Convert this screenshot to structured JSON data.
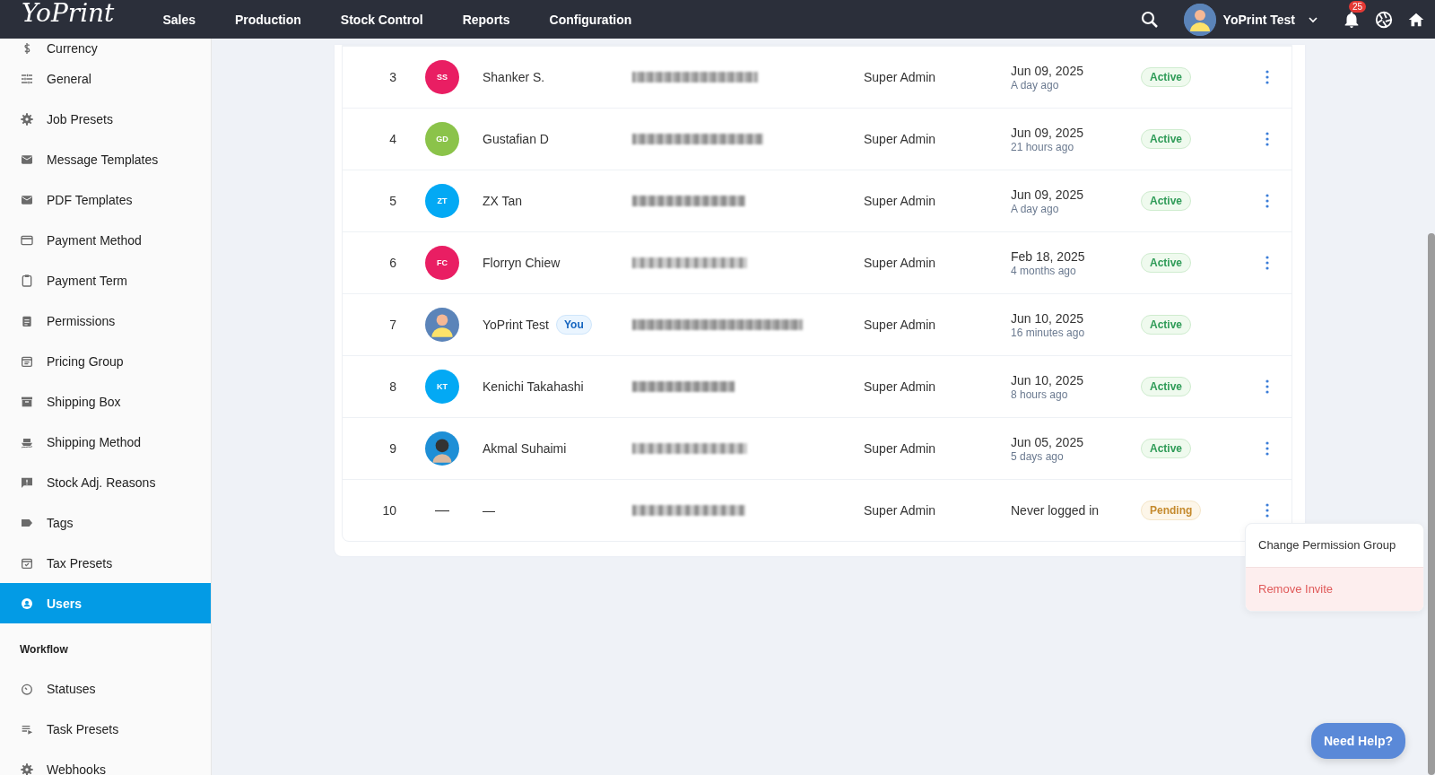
{
  "header": {
    "logo": "YoPrint",
    "nav": [
      {
        "label": "Sales"
      },
      {
        "label": "Production"
      },
      {
        "label": "Stock Control"
      },
      {
        "label": "Reports"
      },
      {
        "label": "Configuration"
      }
    ],
    "user_name": "YoPrint Test",
    "notification_count": "25"
  },
  "sidebar": {
    "items": [
      {
        "label": "Currency",
        "selected": false
      },
      {
        "label": "General",
        "selected": false
      },
      {
        "label": "Job Presets",
        "selected": false
      },
      {
        "label": "Message Templates",
        "selected": false
      },
      {
        "label": "PDF Templates",
        "selected": false
      },
      {
        "label": "Payment Method",
        "selected": false
      },
      {
        "label": "Payment Term",
        "selected": false
      },
      {
        "label": "Permissions",
        "selected": false
      },
      {
        "label": "Pricing Group",
        "selected": false
      },
      {
        "label": "Shipping Box",
        "selected": false
      },
      {
        "label": "Shipping Method",
        "selected": false
      },
      {
        "label": "Stock Adj. Reasons",
        "selected": false
      },
      {
        "label": "Tags",
        "selected": false
      },
      {
        "label": "Tax Presets",
        "selected": false
      },
      {
        "label": "Users",
        "selected": true
      }
    ],
    "section_title": "Workflow",
    "section_items": [
      {
        "label": "Statuses",
        "selected": false
      },
      {
        "label": "Task Presets",
        "selected": false
      },
      {
        "label": "Webhooks",
        "selected": false
      }
    ]
  },
  "users": {
    "rows": [
      {
        "number": "3",
        "avatar": {
          "kind": "initials",
          "text": "SS",
          "color": "#e91e63"
        },
        "name": "Shanker S.",
        "you": false,
        "role": "Super Admin",
        "date": "Jun 09, 2025",
        "ago": "A day ago",
        "status": {
          "kind": "active",
          "label": "Active"
        },
        "menu": true
      },
      {
        "number": "4",
        "avatar": {
          "kind": "initials",
          "text": "GD",
          "color": "#8bc34a"
        },
        "name": "Gustafian D",
        "you": false,
        "role": "Super Admin",
        "date": "Jun 09, 2025",
        "ago": "21 hours ago",
        "status": {
          "kind": "active",
          "label": "Active"
        },
        "menu": true
      },
      {
        "number": "5",
        "avatar": {
          "kind": "initials",
          "text": "ZT",
          "color": "#03a9f4"
        },
        "name": "ZX Tan",
        "you": false,
        "role": "Super Admin",
        "date": "Jun 09, 2025",
        "ago": "A day ago",
        "status": {
          "kind": "active",
          "label": "Active"
        },
        "menu": true
      },
      {
        "number": "6",
        "avatar": {
          "kind": "initials",
          "text": "FC",
          "color": "#e91e63"
        },
        "name": "Florryn Chiew",
        "you": false,
        "role": "Super Admin",
        "date": "Feb 18, 2025",
        "ago": "4 months ago",
        "status": {
          "kind": "active",
          "label": "Active"
        },
        "menu": true
      },
      {
        "number": "7",
        "avatar": {
          "kind": "silhouette"
        },
        "name": "YoPrint Test",
        "you": true,
        "you_label": "You",
        "role": "Super Admin",
        "date": "Jun 10, 2025",
        "ago": "16 minutes ago",
        "status": {
          "kind": "active",
          "label": "Active"
        },
        "menu": false
      },
      {
        "number": "8",
        "avatar": {
          "kind": "initials",
          "text": "KT",
          "color": "#03a9f4"
        },
        "name": "Kenichi Takahashi",
        "you": false,
        "role": "Super Admin",
        "date": "Jun 10, 2025",
        "ago": "8 hours ago",
        "status": {
          "kind": "active",
          "label": "Active"
        },
        "menu": true
      },
      {
        "number": "9",
        "avatar": {
          "kind": "photo"
        },
        "name": "Akmal Suhaimi",
        "you": false,
        "role": "Super Admin",
        "date": "Jun 05, 2025",
        "ago": "5 days ago",
        "status": {
          "kind": "active",
          "label": "Active"
        },
        "menu": true
      },
      {
        "number": "10",
        "avatar": {
          "kind": "none",
          "text": "—"
        },
        "name": "—",
        "you": false,
        "role": "Super Admin",
        "date": "Never logged in",
        "status": {
          "kind": "pending",
          "label": "Pending"
        },
        "menu": true
      }
    ]
  },
  "context_menu": {
    "items": [
      {
        "label": "Change Permission Group",
        "kind": "normal"
      },
      {
        "label": "Remove Invite",
        "kind": "danger"
      }
    ]
  },
  "help_button": "Need Help?"
}
